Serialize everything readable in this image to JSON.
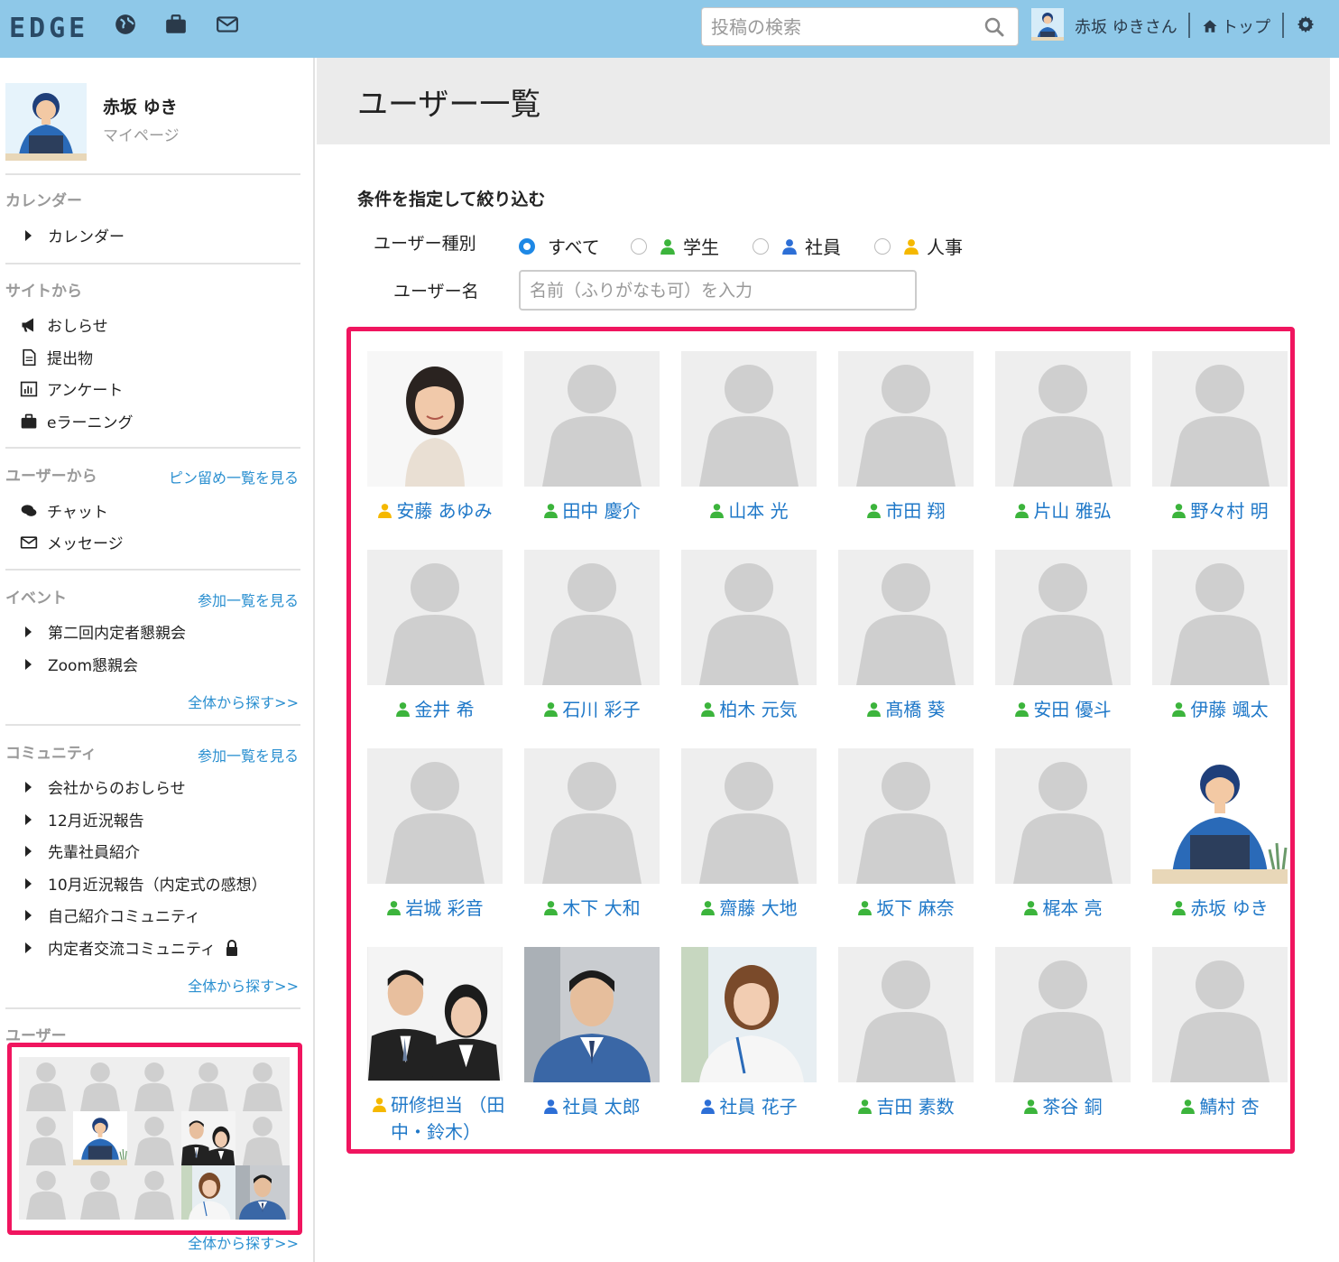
{
  "app": {
    "logo": "EDGE"
  },
  "topbar": {
    "search_placeholder": "投稿の検索",
    "user_label": "赤坂 ゆきさん",
    "home_label": "トップ"
  },
  "sidebar": {
    "profile": {
      "name": "赤坂 ゆき",
      "link": "マイページ"
    },
    "calendar": {
      "title": "カレンダー",
      "items": [
        "カレンダー"
      ]
    },
    "site": {
      "title": "サイトから",
      "items": [
        "おしらせ",
        "提出物",
        "アンケート",
        "eラーニング"
      ]
    },
    "users_from": {
      "title": "ユーザーから",
      "link": "ピン留め一覧を見る",
      "items": [
        "チャット",
        "メッセージ"
      ]
    },
    "events": {
      "title": "イベント",
      "link": "参加一覧を見る",
      "items": [
        "第二回内定者懇親会",
        "Zoom懇親会"
      ],
      "more": "全体から探す>>"
    },
    "community": {
      "title": "コミュニティ",
      "link": "参加一覧を見る",
      "items": [
        "会社からのおしらせ",
        "12月近況報告",
        "先輩社員紹介",
        "10月近況報告（内定式の感想）",
        "自己紹介コミュニティ",
        "内定者交流コミュニティ"
      ],
      "more": "全体から探す>>"
    },
    "users": {
      "title": "ユーザー",
      "more": "全体から探す>>"
    }
  },
  "main": {
    "title": "ユーザー一覧",
    "filter": {
      "title": "条件を指定して絞り込む",
      "type_label": "ユーザー種別",
      "types": [
        "すべて",
        "学生",
        "社員",
        "人事"
      ],
      "selected_type": "すべて",
      "name_label": "ユーザー名",
      "name_placeholder": "名前（ふりがなも可）を入力"
    },
    "users": [
      {
        "name": "安藤 あゆみ",
        "role": "人事",
        "photo": "woman-photo"
      },
      {
        "name": "田中 慶介",
        "role": "学生",
        "photo": "placeholder"
      },
      {
        "name": "山本 光",
        "role": "学生",
        "photo": "placeholder"
      },
      {
        "name": "市田 翔",
        "role": "学生",
        "photo": "placeholder"
      },
      {
        "name": "片山 雅弘",
        "role": "学生",
        "photo": "placeholder"
      },
      {
        "name": "野々村 明",
        "role": "学生",
        "photo": "placeholder"
      },
      {
        "name": "金井 希",
        "role": "学生",
        "photo": "placeholder"
      },
      {
        "name": "石川 彩子",
        "role": "学生",
        "photo": "placeholder"
      },
      {
        "name": "柏木 元気",
        "role": "学生",
        "photo": "placeholder"
      },
      {
        "name": "髙橋 葵",
        "role": "学生",
        "photo": "placeholder"
      },
      {
        "name": "安田 優斗",
        "role": "学生",
        "photo": "placeholder"
      },
      {
        "name": "伊藤 颯太",
        "role": "学生",
        "photo": "placeholder"
      },
      {
        "name": "岩城 彩音",
        "role": "学生",
        "photo": "placeholder"
      },
      {
        "name": "木下 大和",
        "role": "学生",
        "photo": "placeholder"
      },
      {
        "name": "齋藤 大地",
        "role": "学生",
        "photo": "placeholder"
      },
      {
        "name": "坂下 麻奈",
        "role": "学生",
        "photo": "placeholder"
      },
      {
        "name": "梶本 亮",
        "role": "学生",
        "photo": "placeholder"
      },
      {
        "name": "赤坂 ゆき",
        "role": "学生",
        "photo": "illustration"
      },
      {
        "name": "研修担当 （田中・鈴木）",
        "role": "人事",
        "photo": "duo-photo"
      },
      {
        "name": "社員 太郎",
        "role": "社員",
        "photo": "man-photo"
      },
      {
        "name": "社員 花子",
        "role": "社員",
        "photo": "woman2-photo"
      },
      {
        "name": "吉田 素数",
        "role": "学生",
        "photo": "placeholder"
      },
      {
        "name": "茶谷 銅",
        "role": "学生",
        "photo": "placeholder"
      },
      {
        "name": "鯖村 杏",
        "role": "学生",
        "photo": "placeholder"
      }
    ]
  },
  "role_colors": {
    "学生": "#3cb43c",
    "社員": "#2d6fd6",
    "人事": "#f5b800"
  },
  "colors": {
    "topbar": "#8ec8e8",
    "highlight": "#f0155f",
    "link": "#1f78c8"
  }
}
